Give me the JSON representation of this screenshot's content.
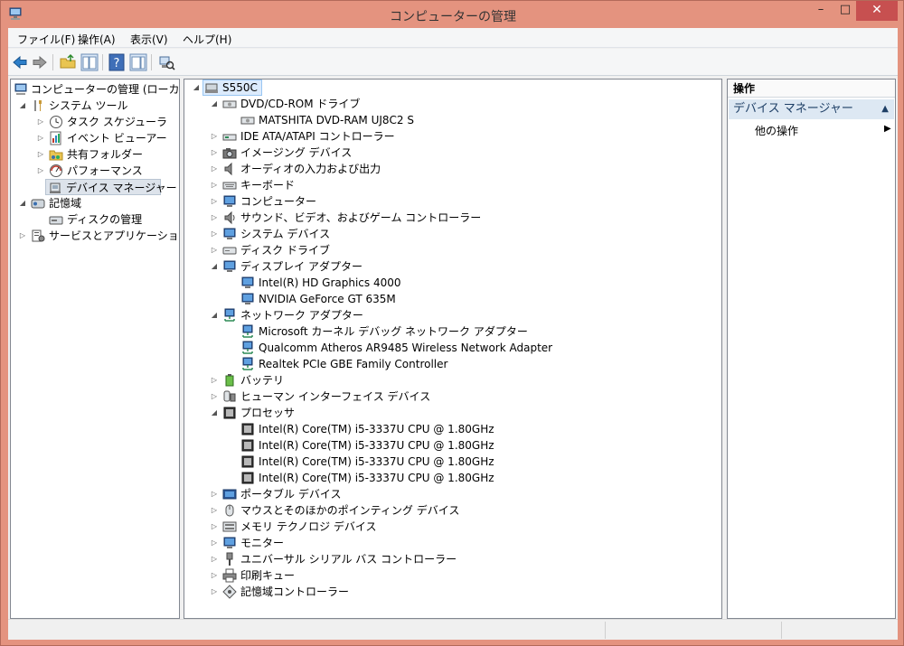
{
  "window": {
    "title": "コンピューターの管理",
    "minimize": "–",
    "maximize": "□",
    "close": "✕"
  },
  "menu": [
    "ファイル(F)",
    "操作(A)",
    "表示(V)",
    "ヘルプ(H)"
  ],
  "tree": {
    "root": "コンピューターの管理 (ローカル)",
    "system_tools": "システム ツール",
    "task_scheduler": "タスク スケジューラ",
    "event_viewer": "イベント ビューアー",
    "shared_folders": "共有フォルダー",
    "performance": "パフォーマンス",
    "device_manager": "デバイス マネージャー",
    "storage": "記憶域",
    "disk_management": "ディスクの管理",
    "services_apps": "サービスとアプリケーション"
  },
  "devices": {
    "root": "S550C",
    "dvd": "DVD/CD-ROM ドライブ",
    "dvd_1": "MATSHITA DVD-RAM UJ8C2 S",
    "ide": "IDE ATA/ATAPI コントローラー",
    "imaging": "イメージング デバイス",
    "audio_io": "オーディオの入力および出力",
    "keyboard": "キーボード",
    "computer": "コンピューター",
    "sound": "サウンド、ビデオ、およびゲーム コントローラー",
    "system": "システム デバイス",
    "disk": "ディスク ドライブ",
    "display": "ディスプレイ アダプター",
    "display_1": "Intel(R) HD Graphics 4000",
    "display_2": "NVIDIA GeForce GT 635M",
    "network": "ネットワーク アダプター",
    "network_1": "Microsoft カーネル デバッグ ネットワーク アダプター",
    "network_2": "Qualcomm Atheros AR9485 Wireless Network Adapter",
    "network_3": "Realtek PCIe GBE Family Controller",
    "battery": "バッテリ",
    "hid": "ヒューマン インターフェイス デバイス",
    "processor": "プロセッサ",
    "cpu": "Intel(R) Core(TM) i5-3337U CPU @ 1.80GHz",
    "portable": "ポータブル デバイス",
    "mouse": "マウスとそのほかのポインティング デバイス",
    "memory": "メモリ テクノロジ デバイス",
    "monitor": "モニター",
    "usb": "ユニバーサル シリアル バス コントローラー",
    "print_queue": "印刷キュー",
    "storage_ctrl": "記憶域コントローラー"
  },
  "actions": {
    "header": "操作",
    "section": "デバイス マネージャー",
    "other": "他の操作"
  },
  "colors": {
    "frame": "#e4937f",
    "close": "#c75050",
    "selection": "#dcebfc"
  }
}
